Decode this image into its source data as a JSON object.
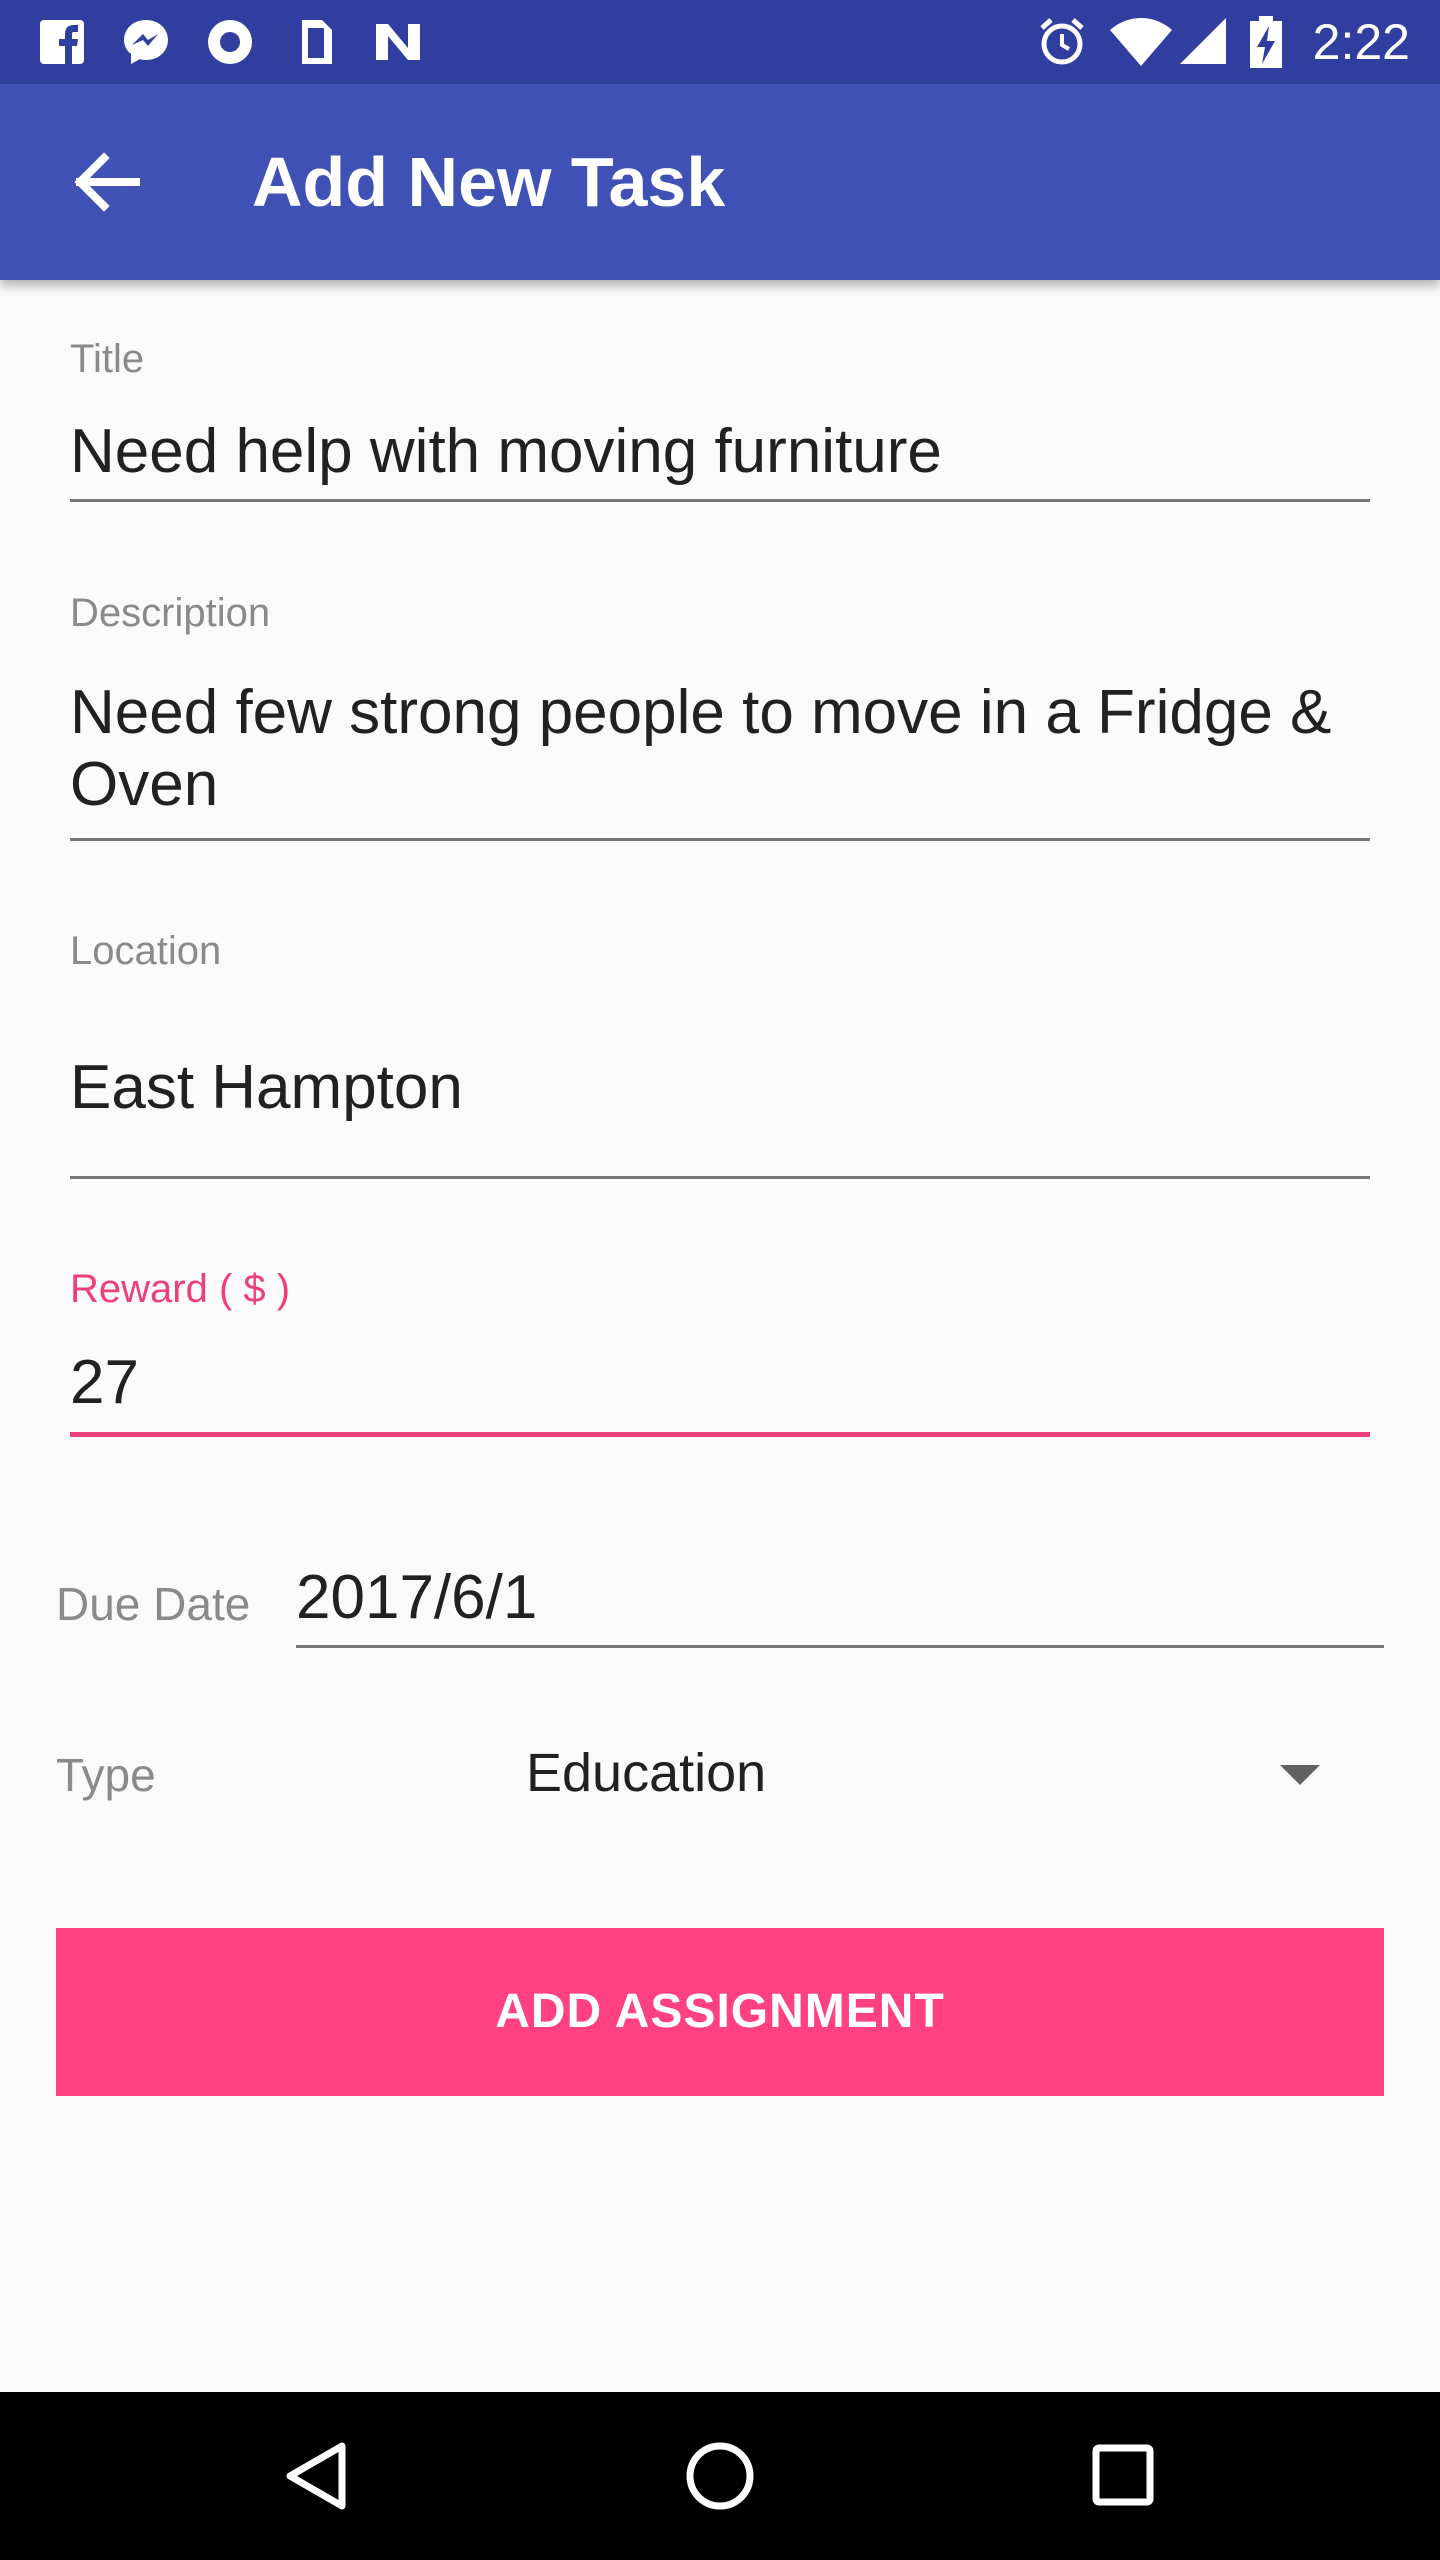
{
  "status_bar": {
    "time": "2:22",
    "left_icons": [
      "facebook-icon",
      "messenger-icon",
      "circle-app-icon",
      "phone-app-icon",
      "n-app-icon"
    ],
    "right_icons": [
      "alarm-icon",
      "wifi-icon",
      "signal-icon",
      "battery-charging-icon"
    ]
  },
  "app_bar": {
    "title": "Add New Task",
    "back_icon": "arrow-left-icon"
  },
  "form": {
    "title": {
      "label": "Title",
      "value": "Need help with moving furniture"
    },
    "description": {
      "label": "Description",
      "value": "Need few strong people to move in a Fridge & Oven"
    },
    "location": {
      "label": "Location",
      "value": "East Hampton"
    },
    "reward": {
      "label": "Reward ( $ )",
      "value": "27"
    },
    "due_date": {
      "label": "Due Date",
      "value": "2017/6/1"
    },
    "type": {
      "label": "Type",
      "value": "Education"
    },
    "submit_label": "ADD ASSIGNMENT"
  },
  "nav_bar": {
    "icons": [
      "back-triangle-icon",
      "home-circle-icon",
      "recents-square-icon"
    ]
  },
  "colors": {
    "status_bar": "#303f9f",
    "app_bar": "#3f51b5",
    "accent": "#ff4081",
    "focused_field": "#ec407a"
  }
}
